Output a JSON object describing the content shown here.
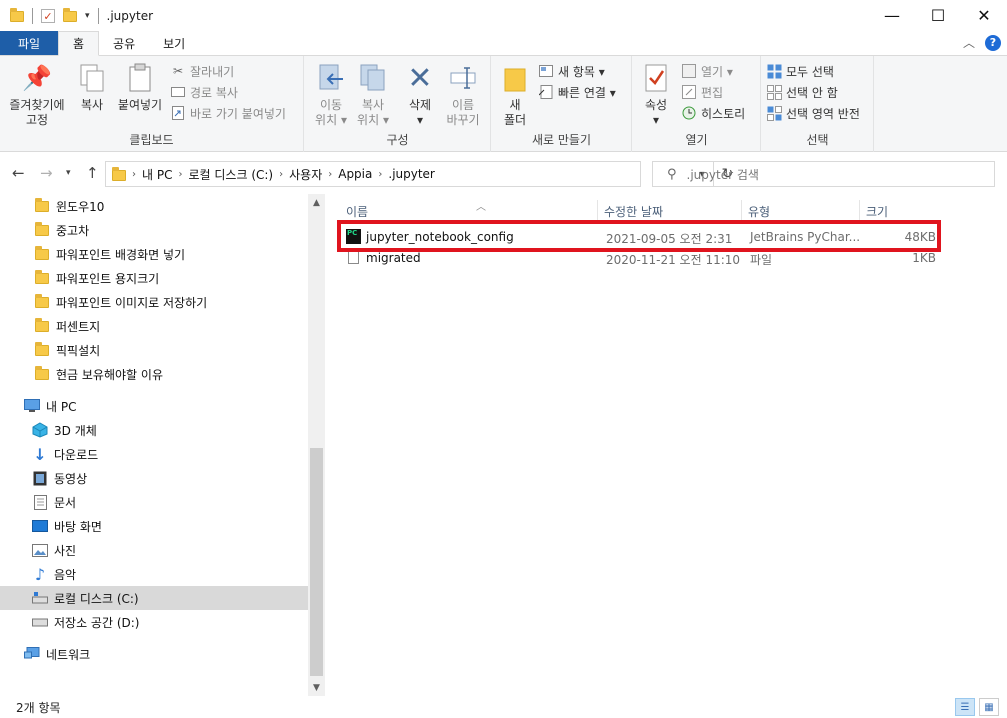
{
  "window": {
    "title": ".jupyter",
    "minimize": "—",
    "maximize": "☐",
    "close": "✕"
  },
  "ribbon_tabs": {
    "file": "파일",
    "home": "홈",
    "share": "공유",
    "view": "보기"
  },
  "ribbon": {
    "clipboard": {
      "label": "클립보드",
      "pin": "즐겨찾기에\n고정",
      "pin_line1": "즐겨찾기에",
      "pin_line2": "고정",
      "copy": "복사",
      "paste": "붙여넣기",
      "cut": "잘라내기",
      "copy_path": "경로 복사",
      "paste_shortcut": "바로 가기 붙여넣기"
    },
    "organize": {
      "label": "구성",
      "move_to_1": "이동",
      "move_to_2": "위치",
      "copy_to_1": "복사",
      "copy_to_2": "위치",
      "delete": "삭제",
      "rename_1": "이름",
      "rename_2": "바꾸기"
    },
    "new": {
      "label": "새로 만들기",
      "new_folder_1": "새",
      "new_folder_2": "폴더",
      "new_item": "새 항목",
      "easy_access": "빠른 연결"
    },
    "open": {
      "label": "열기",
      "properties": "속성",
      "open": "열기",
      "edit": "편집",
      "history": "히스토리"
    },
    "select": {
      "label": "선택",
      "select_all": "모두 선택",
      "select_none": "선택 안 함",
      "invert": "선택 영역 반전"
    }
  },
  "address": {
    "crumbs": [
      "내 PC",
      "로컬 디스크 (C:)",
      "사용자",
      "Appia",
      ".jupyter"
    ],
    "search_placeholder": ".jupyter 검색"
  },
  "nav": {
    "folders": [
      "윈도우10",
      "중고차",
      "파워포인트 배경화면 넣기",
      "파워포인트 용지크기",
      "파워포인트 이미지로 저장하기",
      "퍼센트지",
      "픽픽설치",
      "현금 보유해야할 이유"
    ],
    "this_pc": "내 PC",
    "pc_items": [
      "3D 개체",
      "다운로드",
      "동영상",
      "문서",
      "바탕 화면",
      "사진",
      "음악",
      "로컬 디스크 (C:)",
      "저장소 공간 (D:)"
    ],
    "network": "네트워크"
  },
  "columns": {
    "name": "이름",
    "date": "수정한 날짜",
    "type": "유형",
    "size": "크기"
  },
  "files": [
    {
      "name": "jupyter_notebook_config",
      "date": "2021-09-05 오전 2:31",
      "type": "JetBrains PyChar...",
      "size": "48KB",
      "icon": "pycharm-icon"
    },
    {
      "name": "migrated",
      "date": "2020-11-21 오전 11:10",
      "type": "파일",
      "size": "1KB",
      "icon": "file-icon"
    }
  ],
  "status": {
    "count": "2개 항목"
  },
  "colors": {
    "file_tab": "#1e5ea8",
    "highlight": "#e0141e",
    "folder": "#f7c948"
  }
}
